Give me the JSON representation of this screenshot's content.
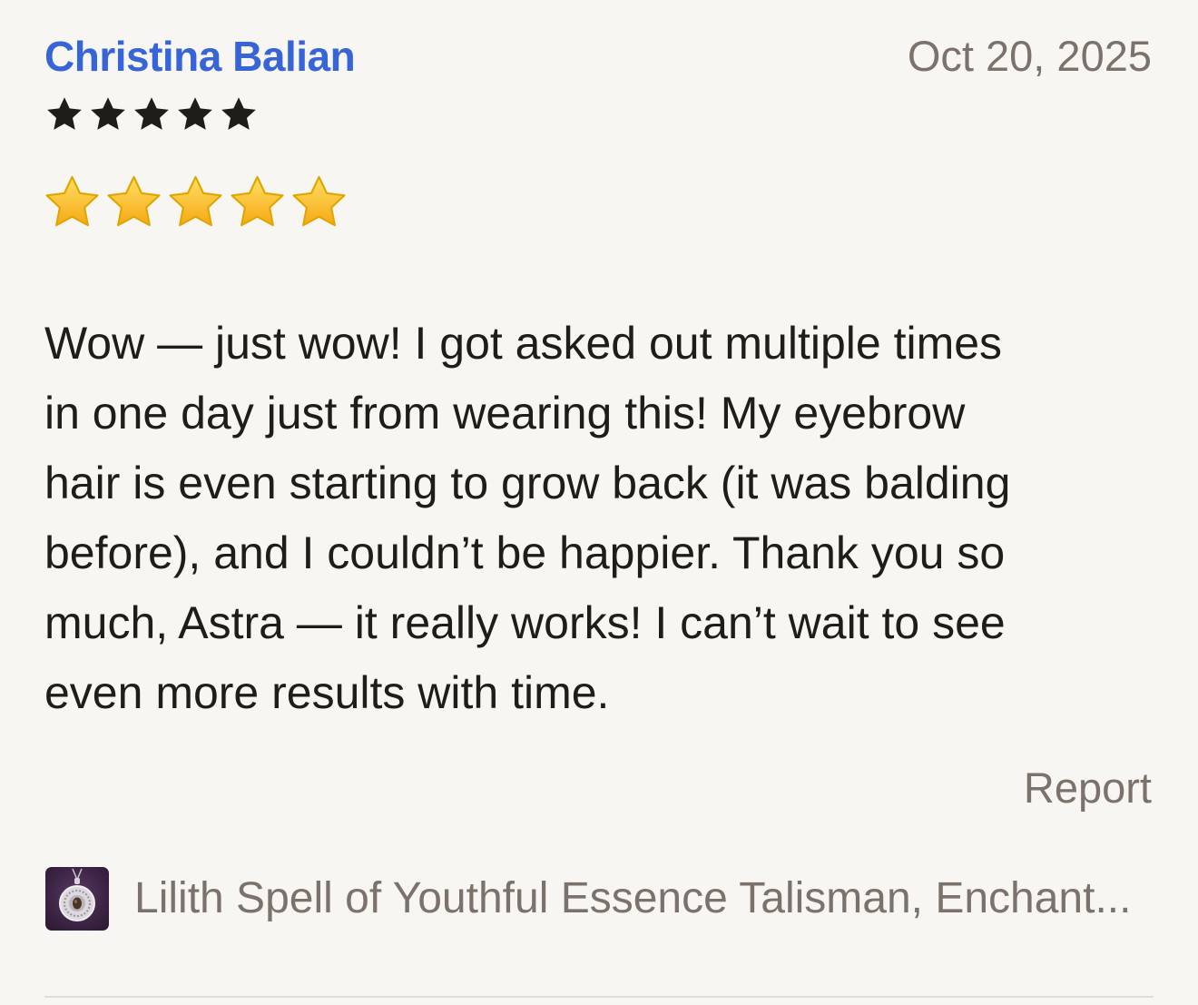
{
  "review": {
    "reviewer_name": "Christina Balian",
    "date": "Oct 20, 2025",
    "rating": 5,
    "rating_max": 5,
    "text_emoji_stars": "⭐⭐⭐⭐⭐",
    "body_lines": [
      "Wow — just wow! I got asked out multiple times",
      "in one day just from wearing this! My eyebrow",
      "hair is even starting to grow back (it was balding",
      "before), and I couldn’t be happier. Thank you so",
      "much, Astra — it really works! I can’t wait to see",
      "even more results with time."
    ],
    "report_label": "Report",
    "product": {
      "title": "Lilith Spell of Youthful Essence Talisman, Enchant...",
      "thumbnail_icon": "pendant-thumbnail"
    }
  },
  "colors": {
    "background": "#f8f6f3",
    "reviewer_name": "#3764d6",
    "muted_text": "#7b726b",
    "body_text": "#1f1c1a",
    "star_fill": "#1f1c1a",
    "emoji_star": "#f7b928"
  }
}
